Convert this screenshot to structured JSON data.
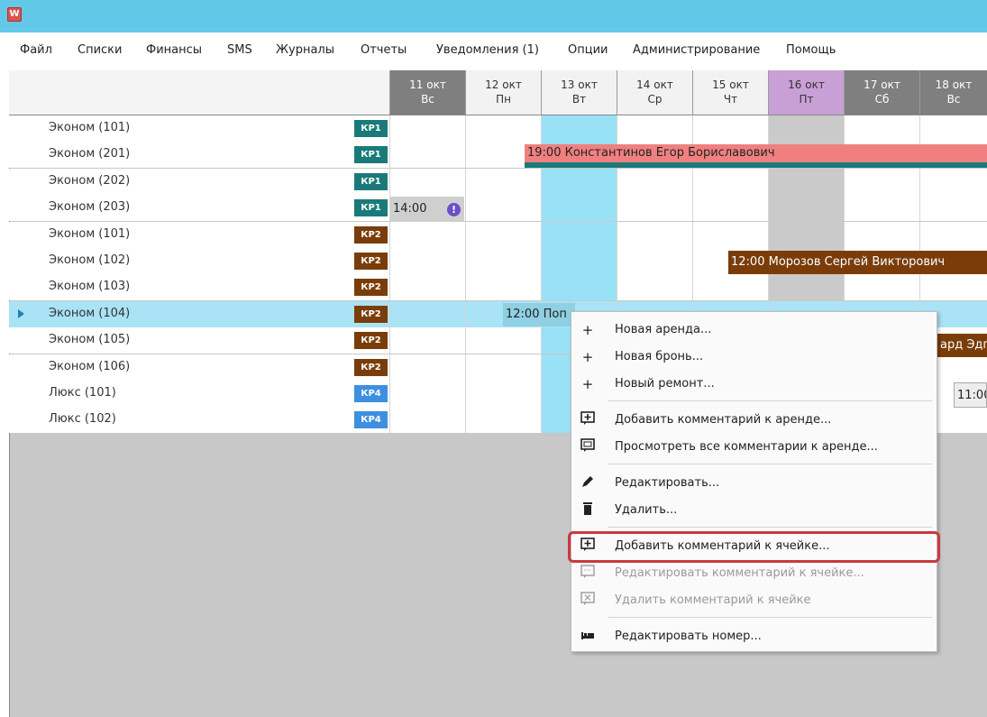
{
  "app": {
    "icon_letter": "W"
  },
  "menu": [
    "Файл",
    "Списки",
    "Финансы",
    "SMS",
    "Журналы",
    "Отчеты",
    "Уведомления (1)",
    "Опции",
    "Администрирование",
    "Помощь"
  ],
  "dates": [
    {
      "day": "11 окт",
      "dow": "Вс"
    },
    {
      "day": "12 окт",
      "dow": "Пн"
    },
    {
      "day": "13 окт",
      "dow": "Вт"
    },
    {
      "day": "14 окт",
      "dow": "Ср"
    },
    {
      "day": "15 окт",
      "dow": "Чт"
    },
    {
      "day": "16 окт",
      "dow": "Пт"
    },
    {
      "day": "17 окт",
      "dow": "Сб"
    },
    {
      "day": "18 окт",
      "dow": "Вс"
    }
  ],
  "rooms": [
    {
      "name": "Эконом (101)",
      "badge": "КР1"
    },
    {
      "name": "Эконом (201)",
      "badge": "КР1"
    },
    {
      "name": "Эконом (202)",
      "badge": "КР1"
    },
    {
      "name": "Эконом (203)",
      "badge": "КР1"
    },
    {
      "name": "Эконом (101)",
      "badge": "КР2"
    },
    {
      "name": "Эконом (102)",
      "badge": "КР2"
    },
    {
      "name": "Эконом (103)",
      "badge": "КР2"
    },
    {
      "name": "Эконом (104)",
      "badge": "КР2"
    },
    {
      "name": "Эконом (105)",
      "badge": "КР2"
    },
    {
      "name": "Эконом (106)",
      "badge": "КР2"
    },
    {
      "name": "Люкс (101)",
      "badge": "КР4"
    },
    {
      "name": "Люкс (102)",
      "badge": "КР4"
    }
  ],
  "bookings": {
    "b1": "19:00 Константинов Егор Бориславович",
    "b2": "14:00",
    "b3": "12:00 Морозов Сергей Викторович",
    "b4": "12:00 Поп",
    "b5": "ард Эдг",
    "b6": "11:00"
  },
  "context_menu": {
    "new_rent": "Новая аренда...",
    "new_reservation": "Новая бронь...",
    "new_repair": "Новый ремонт...",
    "add_rent_comment": "Добавить комментарий к аренде...",
    "view_rent_comments": "Просмотреть все комментарии к аренде...",
    "edit": "Редактировать...",
    "delete": "Удалить...",
    "add_cell_comment": "Добавить комментарий к ячейке...",
    "edit_cell_comment": "Редактировать комментарий к ячейке...",
    "delete_cell_comment": "Удалить комментарий к ячейке",
    "edit_room": "Редактировать номер..."
  },
  "colors": {
    "kr1": "#1a7a7a",
    "kr2": "#7a3d0a",
    "kr4": "#3d8fe0",
    "booking_red": "#f08080",
    "booking_brown": "#7a3d0a",
    "highlight": "#c9393e"
  }
}
